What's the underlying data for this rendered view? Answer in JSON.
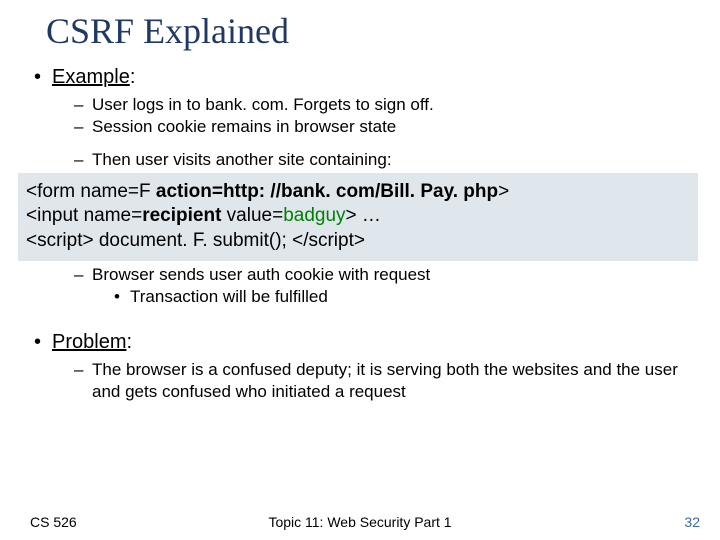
{
  "title": "CSRF Explained",
  "example_label": "Example",
  "bullets": {
    "b1": "User logs in to  bank. com.    Forgets to sign off.",
    "b2": "Session cookie remains in browser state",
    "b3": "Then user visits another site containing:",
    "b4": "Browser sends user auth cookie with request",
    "b5": "Transaction will be fulfilled"
  },
  "code": {
    "l1a": "<form  name=F  ",
    "l1b": "action=http: //bank. com/Bill. Pay. php",
    "l1c": ">",
    "l2a": "<input  name=",
    "l2b": "recipient",
    "l2c": "   value=",
    "l2d": "badguy",
    "l2e": "> …",
    "l3": "<script> document. F. submit(); </scr",
    "l3b": "ipt>"
  },
  "problem_label": "Problem",
  "problem_text": "The browser is a confused deputy; it is serving both the websites and the user and gets confused who initiated a request",
  "footer": {
    "left": "CS 526",
    "center": "Topic 11: Web Security Part 1",
    "right": "32"
  }
}
